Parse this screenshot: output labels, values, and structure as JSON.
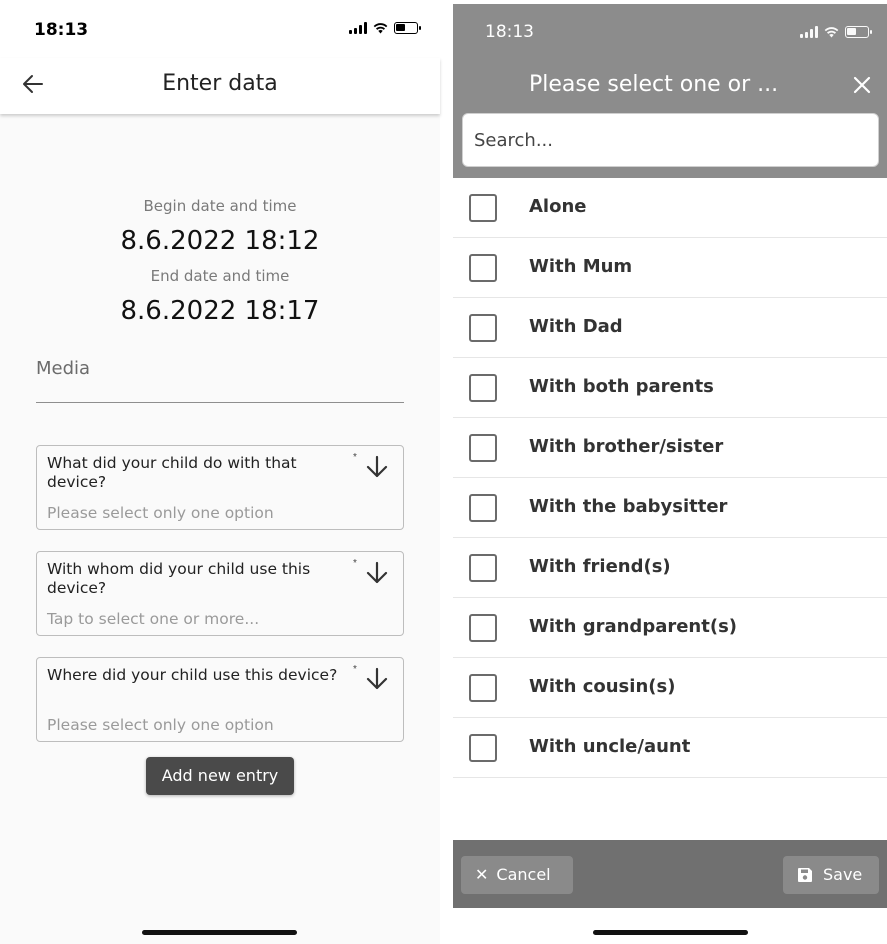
{
  "left": {
    "status_time": "18:13",
    "title": "Enter data",
    "begin_label": "Begin date and time",
    "begin_value": "8.6.2022 18:12",
    "end_label": "End date and time",
    "end_value": "8.6.2022 18:17",
    "media_label": "Media",
    "questions": [
      {
        "question": "What did your child do with that device?",
        "placeholder": "Please select only one option",
        "required_mark": "*"
      },
      {
        "question": "With whom did your child use this device?",
        "placeholder": "Tap to select one or more...",
        "required_mark": "*"
      },
      {
        "question": "Where did your child use this device?",
        "placeholder": "Please select only one option",
        "required_mark": "*"
      }
    ],
    "add_button": "Add new entry"
  },
  "right": {
    "status_time": "18:13",
    "title": "Please select one or ...",
    "search_placeholder": "Search...",
    "options": [
      "Alone",
      "With Mum",
      "With Dad",
      "With both parents",
      "With brother/sister",
      "With the babysitter",
      "With friend(s)",
      "With grandparent(s)",
      "With cousin(s)",
      "With uncle/aunt"
    ],
    "cancel_label": "Cancel",
    "save_label": "Save"
  },
  "colors": {
    "dialog_header": "#8c8c8c",
    "footer": "#707070",
    "button_dark": "#4a4a4a"
  },
  "icons": [
    "back-arrow-icon",
    "arrow-down-icon",
    "close-icon",
    "save-icon",
    "signal-icon",
    "wifi-icon",
    "battery-icon"
  ]
}
